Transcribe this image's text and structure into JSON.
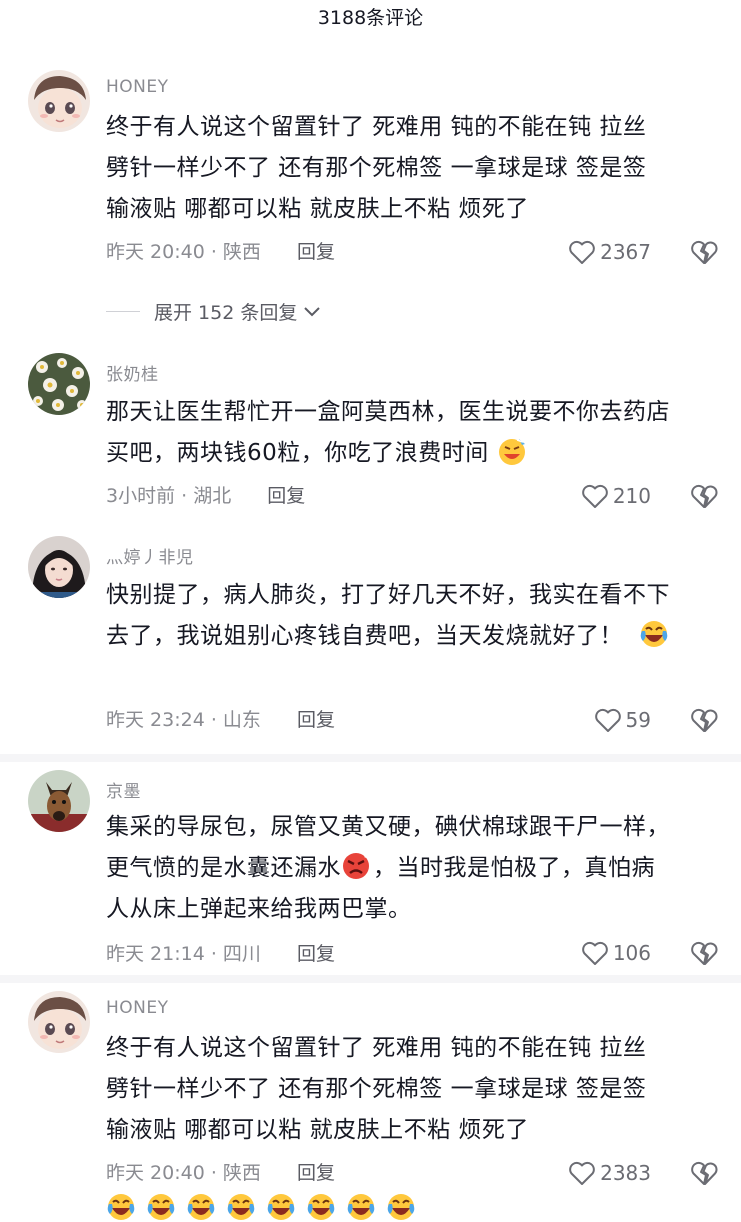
{
  "header": {
    "title": "3188条评论"
  },
  "comments": [
    {
      "user": "HONEY",
      "lines": [
        "终于有人说这个留置针了 死难用 钝的不能在钝  拉丝",
        "劈针一样少不了 还有那个死棉签  一拿球是球 签是签",
        "输液贴 哪都可以粘 就皮肤上不粘 烦死了"
      ],
      "time_loc": "昨天 20:40 · 陕西",
      "reply": "回复",
      "likes": "2367"
    },
    {
      "user": "张奶桂",
      "lines": [
        "那天让医生帮忙开一盒阿莫西林，医生说要不你去药店",
        "买吧，两块钱60粒，你吃了浪费时间"
      ],
      "time_loc": "3小时前 · 湖北",
      "reply": "回复",
      "likes": "210"
    },
    {
      "user": "灬婷丿非児",
      "lines": [
        "快别提了，病人肺炎，打了好几天不好，我实在看不下",
        "去了，我说姐别心疼钱自费吧，当天发烧就好了！"
      ],
      "time_loc": "昨天 23:24 · 山东",
      "reply": "回复",
      "likes": "59"
    },
    {
      "user": "京墨",
      "lines": [
        "集采的导尿包，尿管又黄又硬，碘伏棉球跟干尸一样，",
        "更气愤的是水囊还漏水",
        "，当时我是怕极了，真怕病",
        "人从床上弹起来给我两巴掌。"
      ],
      "time_loc": "昨天 21:14 · 四川",
      "reply": "回复",
      "likes": "106"
    },
    {
      "user": "HONEY",
      "lines": [
        "终于有人说这个留置针了 死难用 钝的不能在钝  拉丝",
        "劈针一样少不了 还有那个死棉签  一拿球是球 签是签",
        "输液贴 哪都可以粘 就皮肤上不粘 烦死了"
      ],
      "time_loc": "昨天 20:40 · 陕西",
      "reply": "回复",
      "likes": "2383"
    }
  ],
  "expand": {
    "label": "展开 152 条回复"
  },
  "icons": {
    "like": "heart-outline-icon",
    "dislike": "broken-heart-icon",
    "expand_chevron": "chevron-down-icon"
  },
  "emoji": {
    "count_row": 8
  }
}
